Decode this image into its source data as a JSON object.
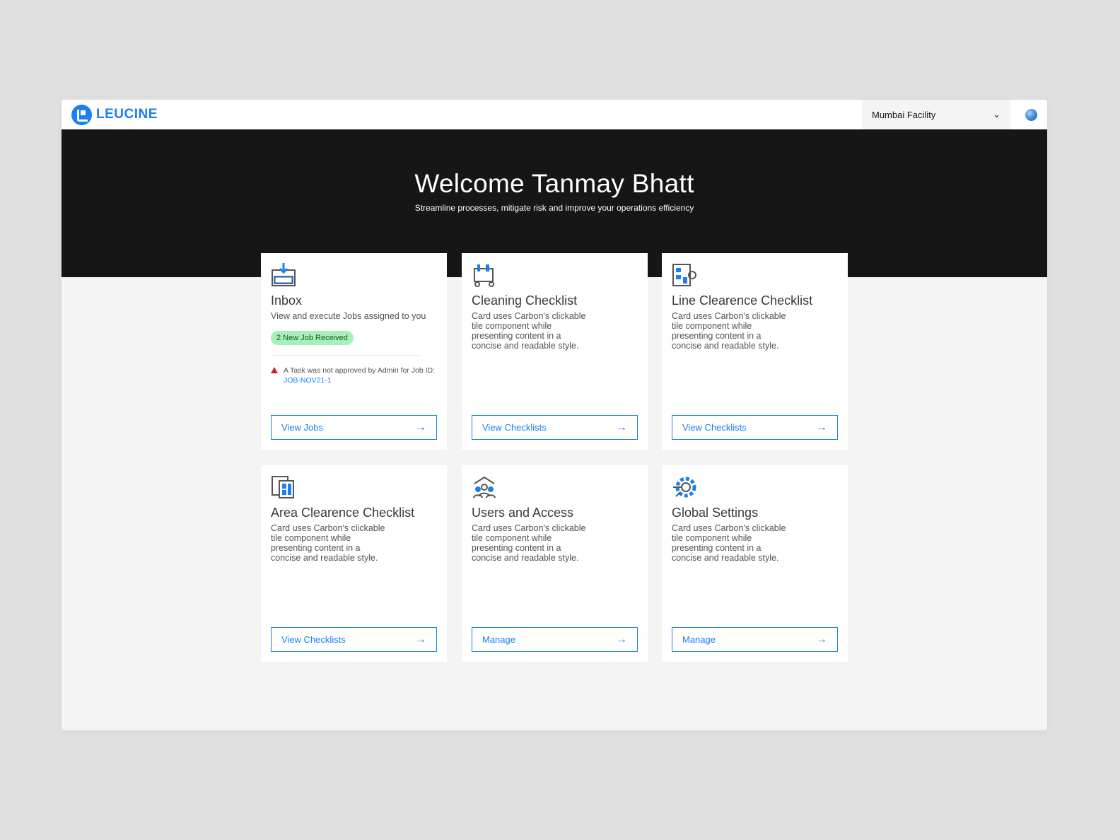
{
  "header": {
    "logo": "LEUCINE",
    "facility": "Mumbai Facility"
  },
  "banner": {
    "title": "Welcome Tanmay Bhatt",
    "subtitle": "Streamline processes, mitigate risk and improve your operations efficiency"
  },
  "cards": [
    {
      "title": "Inbox",
      "desc": "View and execute Jobs assigned to you",
      "badge": "2 New Job Received",
      "warning": "A Task was not approved by Admin for Job ID: ",
      "job_id": "JOB-NOV21-1",
      "button": "View Jobs"
    },
    {
      "title": "Cleaning Checklist",
      "desc": "Card uses Carbon's clickable tile component while presenting content in a concise and readable style.",
      "button": "View Checklists"
    },
    {
      "title": "Line Clearence Checklist",
      "desc": "Card uses Carbon's clickable tile component while presenting content in a concise and readable style.",
      "button": "View Checklists"
    },
    {
      "title": "Area Clearence Checklist",
      "desc": "Card uses Carbon's clickable tile component while presenting content in a concise and readable style.",
      "button": "View Checklists"
    },
    {
      "title": "Users and Access",
      "desc": "Card uses Carbon's clickable tile component while presenting content in a concise and readable style.",
      "button": "Manage"
    },
    {
      "title": "Global Settings",
      "desc": "Card uses Carbon's clickable tile component while presenting content in a concise and readable style.",
      "button": "Manage"
    }
  ]
}
